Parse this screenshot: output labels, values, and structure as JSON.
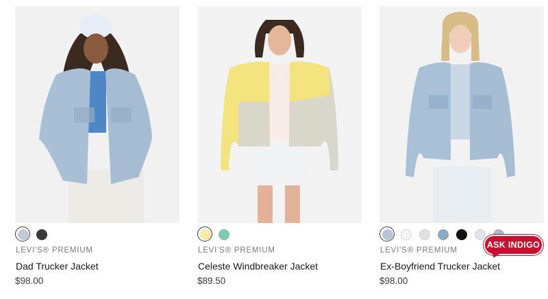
{
  "products": [
    {
      "brand": "LEVI'S® PREMIUM",
      "name": "Dad Trucker Jacket",
      "price": "$98.00",
      "swatches": [
        {
          "color": "#bfcad6",
          "selected": true
        },
        {
          "color": "#3a3a3a",
          "selected": false
        }
      ]
    },
    {
      "brand": "LEVI'S® PREMIUM",
      "name": "Celeste Windbreaker Jacket",
      "price": "$89.50",
      "swatches": [
        {
          "color": "#f6eaa6",
          "selected": true
        },
        {
          "color": "#7fc9b4",
          "selected": false
        }
      ]
    },
    {
      "brand": "LEVI'S® PREMIUM",
      "name": "Ex-Boyfriend Trucker Jacket",
      "price": "$98.00",
      "swatches": [
        {
          "color": "#b7c6d6",
          "selected": true
        },
        {
          "color": "#f4f4f4",
          "selected": false
        },
        {
          "color": "#e0e0e0",
          "selected": false
        },
        {
          "color": "#8fa9c4",
          "selected": false
        },
        {
          "color": "#111111",
          "selected": false
        },
        {
          "color": "#dde4ec",
          "selected": false
        },
        {
          "color": "#a9b9cb",
          "selected": false
        }
      ]
    }
  ],
  "chat": {
    "label": "ASK INDIGO",
    "color": "#c8102e"
  }
}
